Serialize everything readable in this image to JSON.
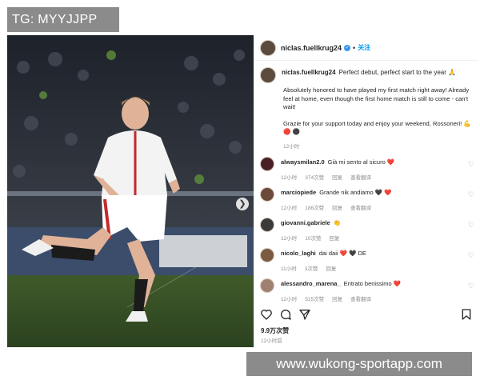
{
  "watermark": {
    "top": "TG: MYYJJPP",
    "bottom": "www.wukong-sportapp.com"
  },
  "header": {
    "username": "niclas.fuellkrug24",
    "follow_label": "关注",
    "dot": "•"
  },
  "caption": {
    "username": "niclas.fuellkrug24",
    "first_line": "Perfect debut, perfect start to the year 🙏",
    "paragraph1": "Absolutely honored to have played my first match right away! Already feel at home, even though the first home match is still to come - can't wait!",
    "paragraph2": "Grazie for your support today and enjoy your weekend, Rossoneri! 💪 🔴 ⚫",
    "time": "12小时"
  },
  "comments": [
    {
      "username": "alwaysmilan2.0",
      "text": "Già mi sento al sicuro ❤️",
      "time": "12小时",
      "likes": "374次赞",
      "reply": "回复",
      "translate": "查看翻译"
    },
    {
      "username": "marciopiede",
      "text": "Grande nik andiamo 🖤 ❤️",
      "time": "12小时",
      "likes": "186次赞",
      "reply": "回复",
      "translate": "查看翻译"
    },
    {
      "username": "giovanni.gabriele",
      "text": "👏",
      "time": "12小时",
      "likes": "10次赞",
      "reply": "回复",
      "translate": ""
    },
    {
      "username": "nicolo_laghi",
      "text": "dai daii ❤️ 🖤 DE",
      "time": "11小时",
      "likes": "3次赞",
      "reply": "回复",
      "translate": ""
    },
    {
      "username": "alessandro_marena_",
      "text": "Entrato benissimo ❤️",
      "time": "12小时",
      "likes": "515次赞",
      "reply": "回复",
      "translate": "查看翻译"
    }
  ],
  "footer": {
    "likes": "9.9万次赞",
    "time": "12小时前"
  },
  "icons": {
    "like": "heart-icon",
    "comment": "comment-icon",
    "share": "share-icon",
    "save": "bookmark-icon",
    "next": "chevron-right-icon",
    "verified": "verified-badge-icon"
  },
  "colors": {
    "follow": "#0095f6",
    "verified": "#3897f0",
    "muted": "#8e8e8e",
    "heart": "#e0245e"
  }
}
